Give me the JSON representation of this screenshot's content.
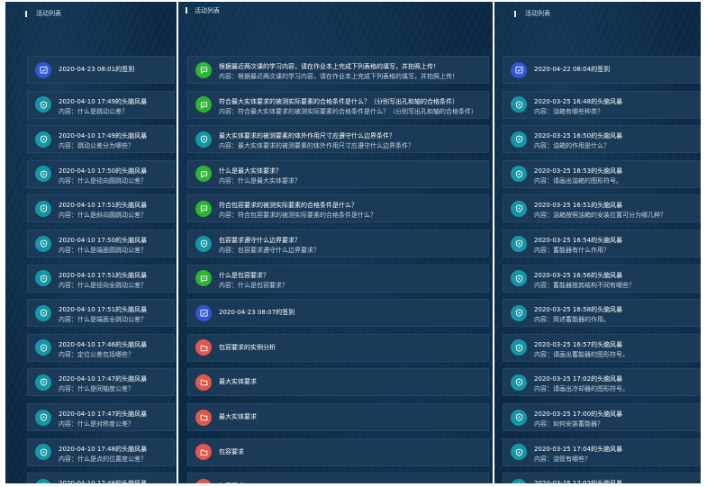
{
  "colors": {
    "panel_bg": "#0c2a45",
    "item_bg": "#1b3a57",
    "teal": "#1596a6",
    "green": "#2fb333",
    "blue": "#2f56d6",
    "red": "#e2574c"
  },
  "content_prefix": "内容：",
  "panels": [
    {
      "title": "活动列表",
      "items": [
        {
          "type": "checkin",
          "icon": "checkin-icon",
          "color": "blue",
          "title": "2020-04-23 08:01的签到"
        },
        {
          "type": "brainstorm",
          "icon": "brainstorm-icon",
          "color": "teal",
          "title": "2020-04-10 17:49的头脑风暴",
          "content": "什么是跳动公差？"
        },
        {
          "type": "brainstorm",
          "icon": "brainstorm-icon",
          "color": "teal",
          "title": "2020-04-10 17:49的头脑风暴",
          "content": "跳动公差分为哪些？"
        },
        {
          "type": "brainstorm",
          "icon": "brainstorm-icon",
          "color": "teal",
          "title": "2020-04-10 17:50的头脑风暴",
          "content": "什么是径向圆跳动公差？"
        },
        {
          "type": "brainstorm",
          "icon": "brainstorm-icon",
          "color": "teal",
          "title": "2020-04-10 17:51的头脑风暴",
          "content": "什么是斜向圆跳动公差？"
        },
        {
          "type": "brainstorm",
          "icon": "brainstorm-icon",
          "color": "teal",
          "title": "2020-04-10 17:50的头脑风暴",
          "content": "什么是端面圆跳动公差？"
        },
        {
          "type": "brainstorm",
          "icon": "brainstorm-icon",
          "color": "teal",
          "title": "2020-04-10 17:51的头脑风暴",
          "content": "什么是径向全跳动公差？"
        },
        {
          "type": "brainstorm",
          "icon": "brainstorm-icon",
          "color": "teal",
          "title": "2020-04-10 17:51的头脑风暴",
          "content": "什么是端面全跳动公差？"
        },
        {
          "type": "brainstorm",
          "icon": "brainstorm-icon",
          "color": "teal",
          "title": "2020-04-10 17:46的头脑风暴",
          "content": "定位公差包括哪些？"
        },
        {
          "type": "brainstorm",
          "icon": "brainstorm-icon",
          "color": "teal",
          "title": "2020-04-10 17:47的头脑风暴",
          "content": "什么是同轴度公差？"
        },
        {
          "type": "brainstorm",
          "icon": "brainstorm-icon",
          "color": "teal",
          "title": "2020-04-10 17:47的头脑风暴",
          "content": "什么是对称度公差？"
        },
        {
          "type": "brainstorm",
          "icon": "brainstorm-icon",
          "color": "teal",
          "title": "2020-04-10 17:48的头脑风暴",
          "content": "什么是点的位置度公差？"
        },
        {
          "type": "brainstorm",
          "icon": "brainstorm-icon",
          "color": "teal",
          "title": "2020-04-10 17:48的头脑风暴",
          "content": "什么是线的位置度公差？"
        }
      ]
    },
    {
      "title": "活动列表",
      "items": [
        {
          "type": "discussion",
          "icon": "chat-icon",
          "color": "green",
          "title": "根据最近两次课的学习内容，请在作业本上完成下列表格的填写，并拍照上传！",
          "content": "根据最近两次课的学习内容，请在作业本上完成下列表格的填写，并拍照上传！"
        },
        {
          "type": "discussion",
          "icon": "chat-icon",
          "color": "green",
          "title": "符合最大实体要求的被测实际要素的合格条件是什么？（分别写出孔和轴的合格条件）",
          "content": "符合最大实体要求的被测实际要素的合格条件是什么？（分别写出孔和轴的合格条件）"
        },
        {
          "type": "brainstorm",
          "icon": "brainstorm-icon",
          "color": "teal",
          "title": "最大实体要求的被测要素的体外作用尺寸应遵守什么边界条件？",
          "content": "最大实体要求的被测要素的体外作用尺寸应遵守什么边界条件？"
        },
        {
          "type": "discussion",
          "icon": "chat-icon",
          "color": "green",
          "title": "什么是最大实体要求？",
          "content": "什么是最大实体要求？"
        },
        {
          "type": "discussion",
          "icon": "chat-icon",
          "color": "green",
          "title": "符合包容要求的被测实际要素的合格条件是什么？",
          "content": "符合包容要求的被测实际要素的合格条件是什么？"
        },
        {
          "type": "brainstorm",
          "icon": "brainstorm-icon",
          "color": "teal",
          "title": "包容要求遵守什么边界要求？",
          "content": "包容要求遵守什么边界要求？"
        },
        {
          "type": "discussion",
          "icon": "chat-icon",
          "color": "green",
          "title": "什么是包容要求？",
          "content": "什么是包容要求？"
        },
        {
          "type": "checkin",
          "icon": "checkin-icon",
          "color": "blue",
          "title": "2020-04-23 08:07的签到"
        },
        {
          "type": "task",
          "icon": "folder-icon",
          "color": "red",
          "title": "包容要求的实例分析"
        },
        {
          "type": "task",
          "icon": "folder-icon",
          "color": "red",
          "title": "最大实体要求"
        },
        {
          "type": "task",
          "icon": "folder-icon",
          "color": "red",
          "title": "最大实体要求"
        },
        {
          "type": "task",
          "icon": "folder-icon",
          "color": "red",
          "title": "包容要求"
        },
        {
          "type": "task",
          "icon": "folder-icon",
          "color": "red",
          "title": "包容要求"
        }
      ]
    },
    {
      "title": "活动列表",
      "items": [
        {
          "type": "checkin",
          "icon": "checkin-icon",
          "color": "blue",
          "title": "2020-04-22 08:04的签到"
        },
        {
          "type": "brainstorm",
          "icon": "brainstorm-icon",
          "color": "teal",
          "title": "2020-03-25 16:48的头脑风暴",
          "content": "油箱有哪些种类？"
        },
        {
          "type": "brainstorm",
          "icon": "brainstorm-icon",
          "color": "teal",
          "title": "2020-03-25 16:50的头脑风暴",
          "content": "油箱的作用是什么？"
        },
        {
          "type": "brainstorm",
          "icon": "brainstorm-icon",
          "color": "teal",
          "title": "2020-03-25 16:53的头脑风暴",
          "content": "请画出油箱的图形符号。"
        },
        {
          "type": "brainstorm",
          "icon": "brainstorm-icon",
          "color": "teal",
          "title": "2020-03-25 16:51的头脑风暴",
          "content": "油箱按照油箱的安装位置可分为哪几种？"
        },
        {
          "type": "brainstorm",
          "icon": "brainstorm-icon",
          "color": "teal",
          "title": "2020-03-25 16:54的头脑风暴",
          "content": "蓄能器有什么作用？"
        },
        {
          "type": "brainstorm",
          "icon": "brainstorm-icon",
          "color": "teal",
          "title": "2020-03-25 16:56的头脑风暴",
          "content": "蓄能器按其结构不同有哪些？"
        },
        {
          "type": "brainstorm",
          "icon": "brainstorm-icon",
          "color": "teal",
          "title": "2020-03-25 16:58的头脑风暴",
          "content": "简述蓄能器的作用。"
        },
        {
          "type": "brainstorm",
          "icon": "brainstorm-icon",
          "color": "teal",
          "title": "2020-03-25 16:57的头脑风暴",
          "content": "请画出蓄能器的图形符号。"
        },
        {
          "type": "brainstorm",
          "icon": "brainstorm-icon",
          "color": "teal",
          "title": "2020-03-25 17:02的头脑风暴",
          "content": "请画出冷却器的图形符号。"
        },
        {
          "type": "brainstorm",
          "icon": "brainstorm-icon",
          "color": "teal",
          "title": "2020-03-25 17:00的头脑风暴",
          "content": "如何安装蓄能器？"
        },
        {
          "type": "brainstorm",
          "icon": "brainstorm-icon",
          "color": "teal",
          "title": "2020-03-25 17:04的头脑风暴",
          "content": "油管有哪些？"
        },
        {
          "type": "brainstorm",
          "icon": "brainstorm-icon",
          "color": "teal",
          "title": "2020-03-25 17:02的头脑风暴",
          "content": "请画出加热器的图形符号。"
        }
      ]
    }
  ]
}
